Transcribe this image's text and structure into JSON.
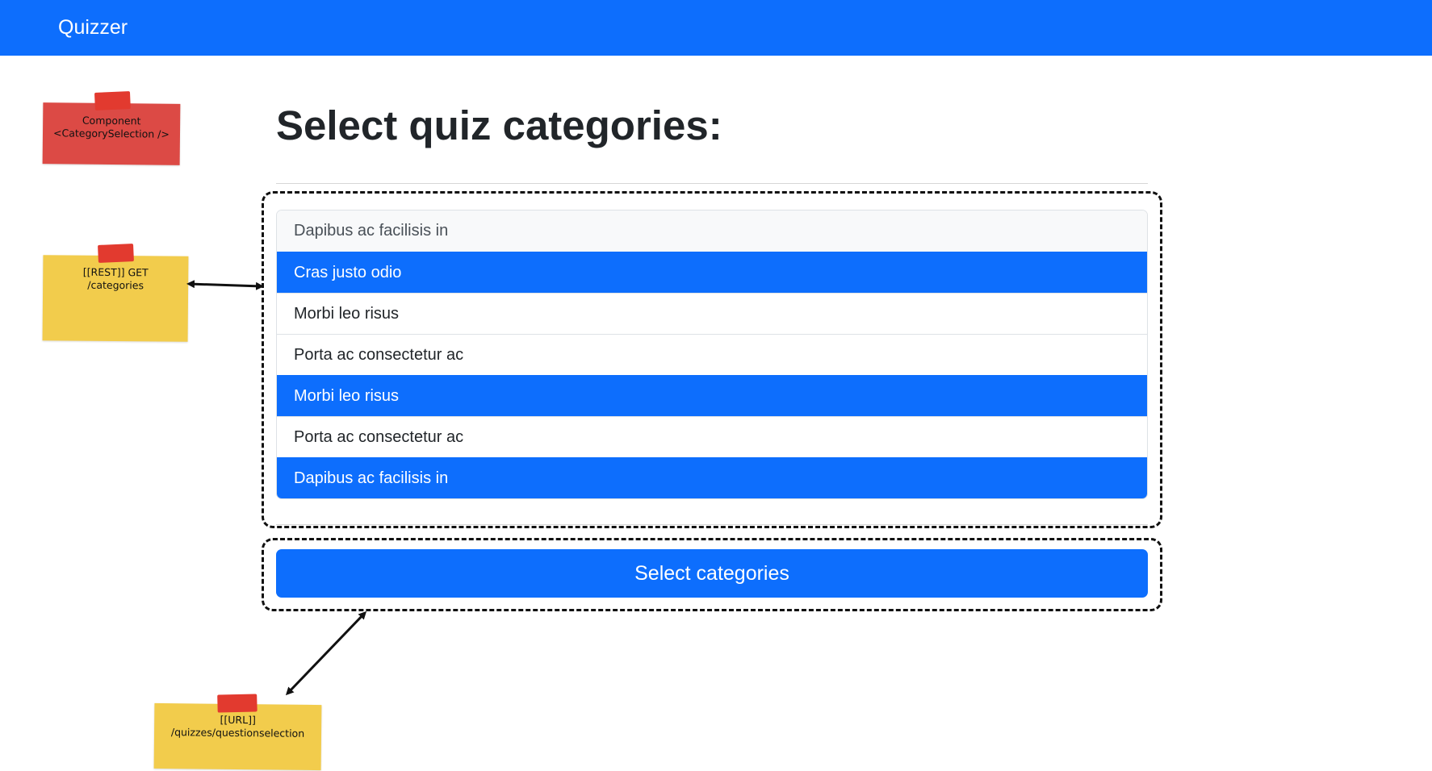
{
  "navbar": {
    "brand": "Quizzer",
    "color": "#0d6efd"
  },
  "main": {
    "title": "Select quiz categories:",
    "categories": [
      {
        "label": "Dapibus ac facilisis in",
        "selected": false
      },
      {
        "label": "Cras justo odio",
        "selected": true
      },
      {
        "label": "Morbi leo risus",
        "selected": false
      },
      {
        "label": "Porta ac consectetur ac",
        "selected": false
      },
      {
        "label": "Morbi leo risus",
        "selected": true
      },
      {
        "label": "Porta ac consectetur ac",
        "selected": false
      },
      {
        "label": "Dapibus ac facilisis in",
        "selected": true
      }
    ],
    "submit_label": "Select categories"
  },
  "annotations": {
    "component_note": {
      "line1": "Component",
      "line2": "<CategorySelection />",
      "color": "#dc4a45"
    },
    "rest_note": {
      "line1": "[[REST]] GET",
      "line2": "/categories",
      "color": "#f2cc4c"
    },
    "url_note": {
      "line1": "[[URL]]",
      "line2": "/quizzes/questionselection",
      "color": "#f2cc4c"
    }
  }
}
